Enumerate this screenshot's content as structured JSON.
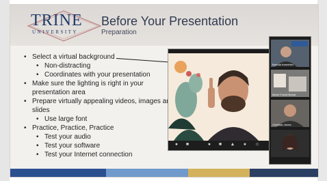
{
  "slide": {
    "logo": {
      "name": "TRINE",
      "sub": "UNIVERSITY"
    },
    "title": "Before Your Presentation",
    "subtitle": "Preparation",
    "bullets": [
      {
        "level": 1,
        "text": "Select a virtual background"
      },
      {
        "level": 2,
        "text": "Non-distracting"
      },
      {
        "level": 2,
        "text": "Coordinates with your presentation"
      },
      {
        "level": 1,
        "text": "Make sure the lighting is right in your presentation area"
      },
      {
        "level": 1,
        "text": "Prepare virtually appealing videos, images and slides"
      },
      {
        "level": 2,
        "text": "Use large font"
      },
      {
        "level": 1,
        "text": "Practice, Practice, Practice"
      },
      {
        "level": 2,
        "text": "Test your audio"
      },
      {
        "level": 2,
        "text": "Test your software"
      },
      {
        "level": 2,
        "text": "Test your Internet connection"
      }
    ]
  },
  "gallery": {
    "participants": [
      "Brenda Ireserhier",
      "Marie Forest Brand",
      "Christian Jones",
      ""
    ]
  },
  "colors": {
    "logo": "#1e3a6b",
    "footer": [
      "#2c4f8f",
      "#6f9acb",
      "#d3b25b",
      "#2b3f63"
    ]
  }
}
